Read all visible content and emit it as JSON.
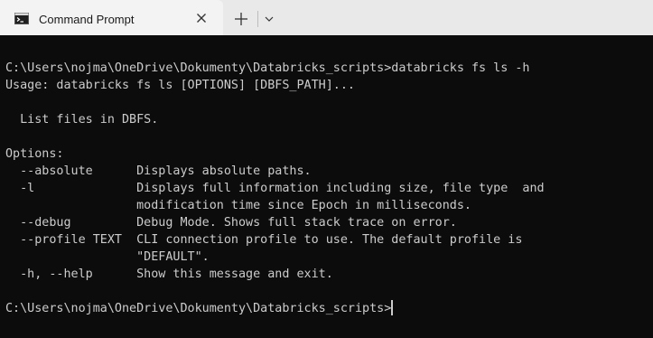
{
  "tab": {
    "title": "Command Prompt",
    "icon": "command-prompt-icon",
    "close_icon": "close-icon",
    "new_tab_icon": "plus-icon",
    "menu_icon": "chevron-down-icon"
  },
  "terminal": {
    "lines": [
      "",
      "C:\\Users\\nojma\\OneDrive\\Dokumenty\\Databricks_scripts>databricks fs ls -h",
      "Usage: databricks fs ls [OPTIONS] [DBFS_PATH]...",
      "",
      "  List files in DBFS.",
      "",
      "Options:",
      "  --absolute      Displays absolute paths.",
      "  -l              Displays full information including size, file type  and",
      "                  modification time since Epoch in milliseconds.",
      "  --debug         Debug Mode. Shows full stack trace on error.",
      "  --profile TEXT  CLI connection profile to use. The default profile is",
      "                  \"DEFAULT\".",
      "  -h, --help      Show this message and exit.",
      "",
      "C:\\Users\\nojma\\OneDrive\\Dokumenty\\Databricks_scripts>"
    ]
  }
}
